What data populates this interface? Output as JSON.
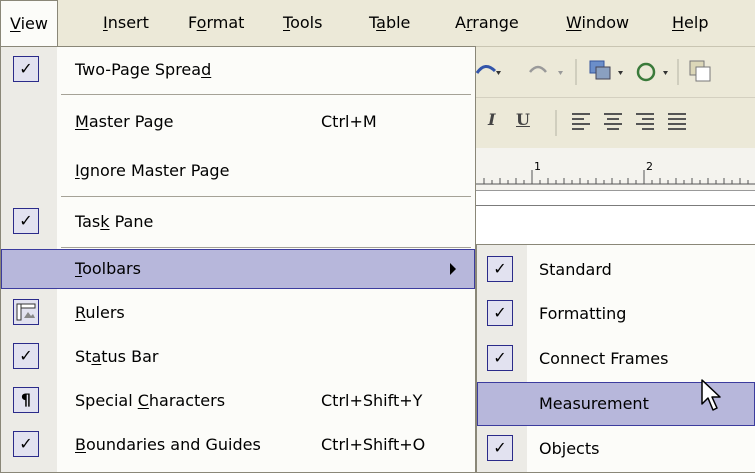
{
  "menubar": {
    "items": [
      {
        "pre": "",
        "u": "V",
        "post": "iew"
      },
      {
        "pre": "",
        "u": "I",
        "post": "nsert"
      },
      {
        "pre": "F",
        "u": "o",
        "post": "rmat"
      },
      {
        "pre": "",
        "u": "T",
        "post": "ools"
      },
      {
        "pre": "T",
        "u": "a",
        "post": "ble"
      },
      {
        "pre": "A",
        "u": "r",
        "post": "range"
      },
      {
        "pre": "",
        "u": "W",
        "post": "indow"
      },
      {
        "pre": "",
        "u": "H",
        "post": "elp"
      }
    ]
  },
  "view_menu": {
    "items": [
      {
        "pre": "Two-Page Sprea",
        "u": "d",
        "post": "",
        "shortcut": "",
        "icon": "check-icon"
      },
      {
        "pre": "",
        "u": "M",
        "post": "aster Page",
        "shortcut": "Ctrl+M",
        "icon": ""
      },
      {
        "pre": "",
        "u": "I",
        "post": "gnore Master Page",
        "shortcut": "",
        "icon": ""
      },
      {
        "pre": "Tas",
        "u": "k",
        "post": " Pane",
        "shortcut": "",
        "icon": "check-icon"
      },
      {
        "pre": "",
        "u": "T",
        "post": "oolbars",
        "shortcut": "",
        "icon": ""
      },
      {
        "pre": "",
        "u": "R",
        "post": "ulers",
        "shortcut": "",
        "icon": "rulers-icon"
      },
      {
        "pre": "St",
        "u": "a",
        "post": "tus Bar",
        "shortcut": "",
        "icon": "check-icon"
      },
      {
        "pre": "Special ",
        "u": "C",
        "post": "haracters",
        "shortcut": "Ctrl+Shift+Y",
        "icon": "pilcrow-icon"
      },
      {
        "pre": "",
        "u": "B",
        "post": "oundaries and Guides",
        "shortcut": "Ctrl+Shift+O",
        "icon": "check-icon"
      }
    ]
  },
  "toolbars_submenu": {
    "items": [
      {
        "label": "Standard",
        "checked": true
      },
      {
        "label": "Formatting",
        "checked": true
      },
      {
        "label": "Connect Frames",
        "checked": true
      },
      {
        "label": "Measurement",
        "checked": false
      },
      {
        "label": "Objects",
        "checked": true
      }
    ]
  },
  "glyphs": {
    "check": "✓",
    "pilcrow": "¶"
  },
  "toolbar_preview": {
    "bold_italic_i": "I",
    "underline_u": "U"
  },
  "ruler": {
    "labels": [
      "1",
      "2"
    ]
  },
  "colors": {
    "menu_bg": "#fcfcf9",
    "highlight": "#b7b7db",
    "highlight_border": "#3c3c9e",
    "menubar_bg": "#ece9d8"
  }
}
